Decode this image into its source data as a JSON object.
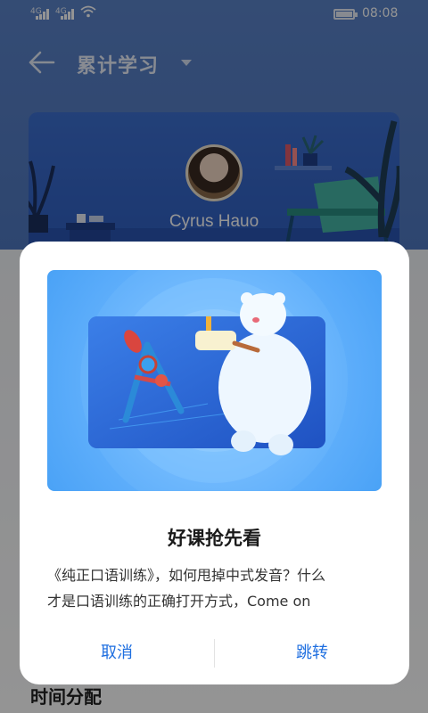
{
  "status_bar": {
    "signal_1": "4G",
    "signal_2": "4G",
    "time": "08:08"
  },
  "header": {
    "title": "累计学习"
  },
  "profile": {
    "name": "Cyrus Hauo"
  },
  "section": {
    "heading": "时间分配"
  },
  "dialog": {
    "title": "好课抢先看",
    "body_line_1": "《纯正口语训练》，如何甩掉中式发音？什么",
    "body_line_2": "才是口语训练的正确打开方式，Come on",
    "cancel_label": "取消",
    "confirm_label": "跳转"
  },
  "colors": {
    "accent": "#1f6fe0",
    "header_bg": "#5b83c9",
    "banner_bg": "#7cc0ff"
  }
}
